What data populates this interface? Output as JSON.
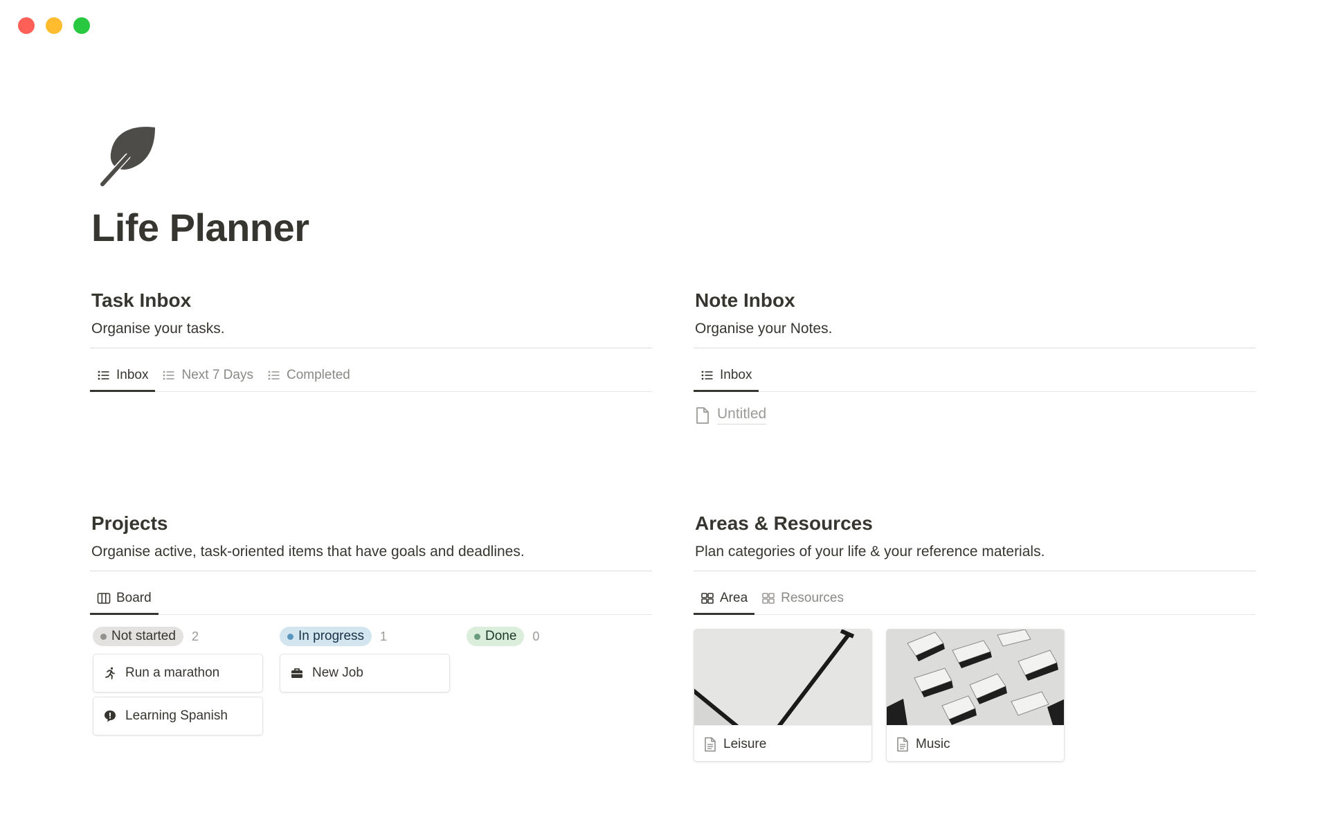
{
  "window": {
    "controls": [
      {
        "name": "close",
        "color": "#fe5f57"
      },
      {
        "name": "minimize",
        "color": "#febc2e"
      },
      {
        "name": "zoom",
        "color": "#28c840"
      }
    ]
  },
  "page": {
    "icon": "leaf-icon",
    "title": "Life Planner"
  },
  "task_inbox": {
    "title": "Task Inbox",
    "description": "Organise your tasks.",
    "tabs": [
      {
        "label": "Inbox",
        "icon": "list-icon",
        "active": true
      },
      {
        "label": "Next 7 Days",
        "icon": "list-icon",
        "active": false
      },
      {
        "label": "Completed",
        "icon": "list-icon",
        "active": false
      }
    ]
  },
  "note_inbox": {
    "title": "Note Inbox",
    "description": "Organise your Notes.",
    "tabs": [
      {
        "label": "Inbox",
        "icon": "list-icon",
        "active": true
      }
    ],
    "items": [
      {
        "label": "Untitled",
        "icon": "page-icon"
      }
    ]
  },
  "projects": {
    "title": "Projects",
    "description": "Organise active, task-oriented items that have goals and deadlines.",
    "tabs": [
      {
        "label": "Board",
        "icon": "board-icon",
        "active": true
      }
    ],
    "columns": [
      {
        "status": "Not started",
        "count": "2",
        "pill_bg": "#e3e2e0",
        "dot": "#91918e",
        "text": "#37352f",
        "cards": [
          {
            "label": "Run a marathon",
            "icon": "runner-icon"
          },
          {
            "label": "Learning Spanish",
            "icon": "speech-bubble-icon"
          }
        ]
      },
      {
        "status": "In progress",
        "count": "1",
        "pill_bg": "#d3e5ef",
        "dot": "#5b97bd",
        "text": "#183347",
        "cards": [
          {
            "label": "New Job",
            "icon": "briefcase-icon"
          }
        ]
      },
      {
        "status": "Done",
        "count": "0",
        "pill_bg": "#dbeddb",
        "dot": "#6c9b7d",
        "text": "#1c3829",
        "cards": []
      }
    ]
  },
  "areas": {
    "title": "Areas & Resources",
    "description": "Plan categories of your life & your reference materials.",
    "tabs": [
      {
        "label": "Area",
        "icon": "gallery-icon",
        "active": true
      },
      {
        "label": "Resources",
        "icon": "gallery-icon",
        "active": false
      }
    ],
    "cards": [
      {
        "label": "Leisure",
        "icon": "page-icon",
        "cover": "abstract-lines-cover"
      },
      {
        "label": "Music",
        "icon": "page-icon",
        "cover": "scattered-blocks-cover"
      }
    ]
  }
}
